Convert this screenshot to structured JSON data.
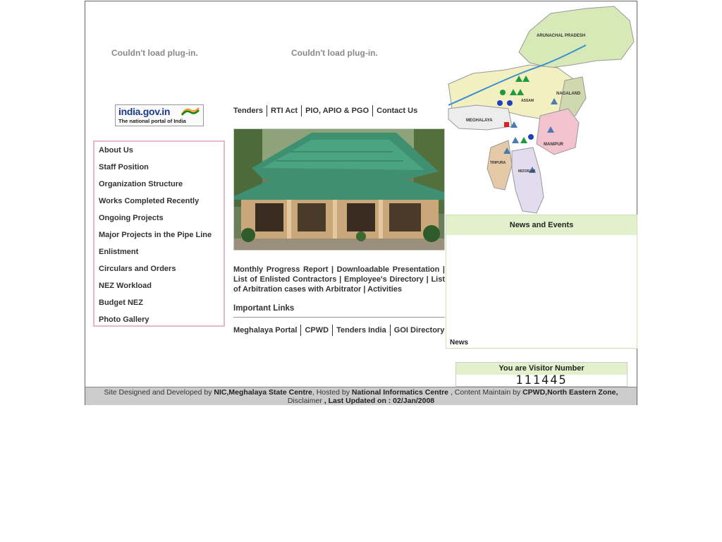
{
  "plugin": {
    "left_msg": "Couldn't load plug-in.",
    "right_msg": "Couldn't load plug-in."
  },
  "india_logo": {
    "title": "india.gov.in",
    "subtitle": "The national portal of India"
  },
  "sidebar": {
    "items": [
      {
        "label": "About Us"
      },
      {
        "label": "Staff Position"
      },
      {
        "label": "Organization Structure"
      },
      {
        "label": "Works Completed Recently"
      },
      {
        "label": "Ongoing Projects"
      },
      {
        "label": "Major Projects in the Pipe Line"
      },
      {
        "label": "Enlistment"
      },
      {
        "label": "Circulars and Orders"
      },
      {
        "label": "NEZ Workload"
      },
      {
        "label": "Budget NEZ"
      },
      {
        "label": "Photo Gallery"
      }
    ]
  },
  "top_links": {
    "tenders": "Tenders",
    "rti": "RTI Act",
    "pio": "PIO, APIO & PGO",
    "contact": "Contact Us"
  },
  "report_links": {
    "monthly": "Monthly Progress Report",
    "presentation": "Downloadable Presentation",
    "contractors": "List of Enlisted Contractors",
    "directory": "Employee's Directory",
    "arbitration": "List of Arbitration cases with Arbitrator",
    "activities": "Activities",
    "sep": "|"
  },
  "important_links": {
    "title": "Important Links",
    "meghalaya": "Meghalaya Portal",
    "cpwd": "CPWD",
    "tenders_india": "Tenders India",
    "goi": "GOI Directory"
  },
  "map": {
    "labels": {
      "arunachal": "ARUNACHAL PRADESH",
      "nagaland": "NAGALAND",
      "assam": "ASSAM",
      "meghalaya": "MEGHALAYA",
      "manipur": "MANIPUR",
      "tripura": "TRIPURA",
      "mizoram": "MIZORAM"
    }
  },
  "news": {
    "title": "News and Events",
    "item": "News"
  },
  "visitor": {
    "title": "You are Visitor Number",
    "count": "111445"
  },
  "footer": {
    "p1": "Site Designed and Developed by ",
    "b1": "NIC,Meghalaya State Centre",
    "p2": ", Hosted by ",
    "b2": "National Informatics Centre",
    "p3": " , Content Maintain by ",
    "b3": "CPWD,North Eastern Zone,",
    "p4": "Disclaimer ",
    "b4": ", Last Updated on : 02/Jan/2008"
  },
  "colors": {
    "nav_border": "#e8b8c8",
    "news_head_bg": "#e3f0cc",
    "footer_bg": "#cccccc"
  }
}
